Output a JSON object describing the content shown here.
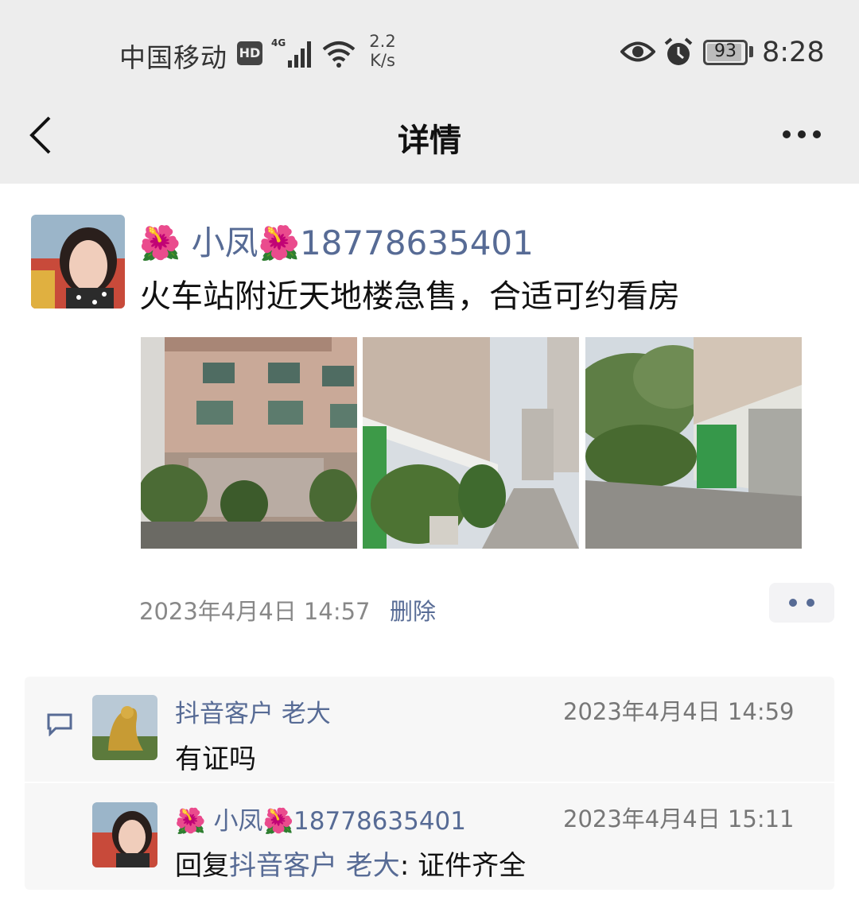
{
  "status_bar": {
    "carrier": "中国移动",
    "hd_badge": "HD",
    "network": "4G",
    "speed_value": "2.2",
    "speed_unit": "K/s",
    "battery": "93",
    "battery_level": 0.93,
    "time": "8:28",
    "icons": [
      "eye-icon",
      "alarm-icon",
      "wifi-icon",
      "signal-icon"
    ]
  },
  "nav": {
    "title": "详情",
    "back_icon": "chevron-left-icon",
    "more_icon": "more-dots-icon"
  },
  "post": {
    "author": "🌺 小凤🌺18778635401",
    "text": "火车站附近天地楼急售，合适可约看房",
    "timestamp": "2023年4月4日 14:57",
    "delete_label": "删除",
    "photos": [
      "photo-building-front",
      "photo-alley",
      "photo-courtyard"
    ]
  },
  "comments": [
    {
      "author": "抖音客户  老大",
      "time": "2023年4月4日 14:59",
      "text": "有证吗"
    },
    {
      "author": "🌺 小凤🌺18778635401",
      "time": "2023年4月4日 15:11",
      "reply_prefix": "回复",
      "reply_to": "抖音客户  老大",
      "reply_text": ": 证件齐全"
    }
  ],
  "colors": {
    "link": "#576b95",
    "header_bg": "#ededed",
    "comment_bg": "#f7f7f7"
  }
}
